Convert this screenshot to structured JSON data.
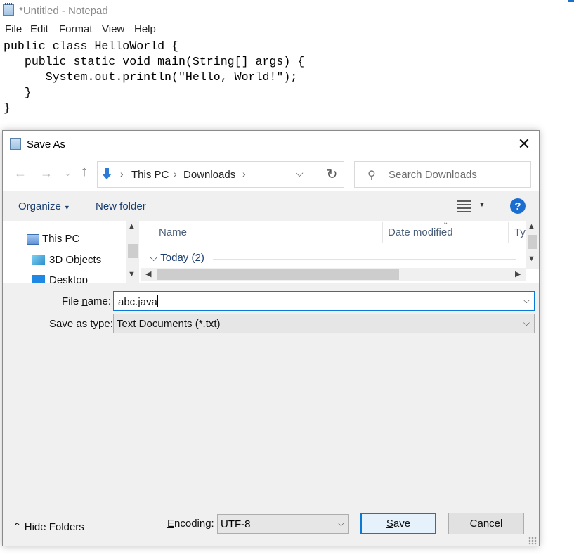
{
  "notepad": {
    "title": "*Untitled - Notepad",
    "menu": [
      "File",
      "Edit",
      "Format",
      "View",
      "Help"
    ],
    "code_lines": [
      "public class HelloWorld {",
      "   public static void main(String[] args) {",
      "      System.out.println(\"Hello, World!\");",
      "   }",
      "}"
    ]
  },
  "dialog": {
    "title": "Save As",
    "close_glyph": "✕",
    "nav": {
      "back": "←",
      "forward": "→",
      "recent": "⌄",
      "up": "↑"
    },
    "address": {
      "segments": [
        "This PC",
        "Downloads"
      ],
      "separator": "›"
    },
    "search": {
      "placeholder": "Search Downloads"
    },
    "commands": {
      "organize": "Organize",
      "new_folder": "New folder",
      "help": "?"
    },
    "tree": [
      "This PC",
      "3D Objects",
      "Desktop"
    ],
    "columns": [
      "Name",
      "Date modified",
      "Ty"
    ],
    "group": {
      "label": "Today (2)"
    },
    "file_name": {
      "label_pre": "File ",
      "label_u": "n",
      "label_post": "ame:",
      "value": "abc.java"
    },
    "save_type": {
      "label_pre": "Save as ",
      "label_u": "t",
      "label_post": "ype:",
      "value": "Text Documents (*.txt)"
    },
    "hide_folders": "Hide Folders",
    "encoding": {
      "label_u": "E",
      "label_post": "ncoding:",
      "value": "UTF-8"
    },
    "buttons": {
      "save_u": "S",
      "save_post": "ave",
      "cancel": "Cancel"
    }
  },
  "colors": {
    "accent": "#0a78d7",
    "help": "#1b6ed0",
    "link": "#1e3f73"
  }
}
